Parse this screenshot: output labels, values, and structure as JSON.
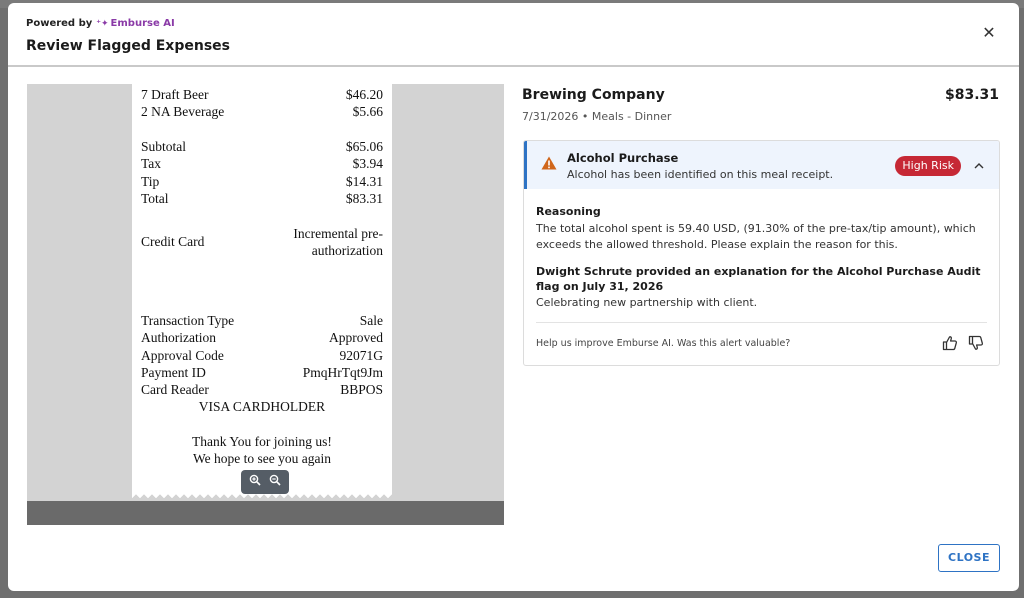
{
  "header": {
    "powered_by": "Powered by",
    "brand": "Emburse AI",
    "title": "Review Flagged Expenses",
    "close_icon": "close-icon"
  },
  "receipt": {
    "rows_top": [
      {
        "label": "7 Draft Beer",
        "value": "$46.20"
      },
      {
        "label": "2 NA Beverage",
        "value": "$5.66"
      }
    ],
    "rows_totals": [
      {
        "label": "Subtotal",
        "value": "$65.06"
      },
      {
        "label": "Tax",
        "value": "$3.94"
      },
      {
        "label": "Tip",
        "value": "$14.31"
      },
      {
        "label": "Total",
        "value": "$83.31"
      }
    ],
    "credit_card": {
      "label": "Credit Card",
      "value": "Incremental pre-authorization"
    },
    "rows_txn": [
      {
        "label": "Transaction Type",
        "value": "Sale"
      },
      {
        "label": "Authorization",
        "value": "Approved"
      },
      {
        "label": "Approval Code",
        "value": "92071G"
      },
      {
        "label": "Payment ID",
        "value": "PmqHrTqt9Jm"
      },
      {
        "label": "Card Reader",
        "value": "BBPOS"
      }
    ],
    "cardholder": "VISA CARDHOLDER",
    "thanks_1": "Thank You for joining us!",
    "thanks_2": "We hope to see you again",
    "zoom_in_icon": "zoom-in-icon",
    "zoom_out_icon": "zoom-out-icon"
  },
  "expense": {
    "merchant": "Brewing Company",
    "amount": "$83.31",
    "meta": "7/31/2026 • Meals - Dinner"
  },
  "alert": {
    "icon": "warning-icon",
    "title": "Alcohol Purchase",
    "subtitle": "Alcohol has been identified on this meal receipt.",
    "badge": "High Risk",
    "badge_color": "#c62835",
    "reasoning_title": "Reasoning",
    "reasoning_text": "The total alcohol spent is 59.40 USD, (91.30% of the pre-tax/tip amount), which exceeds the allowed threshold. Please explain the reason for this.",
    "explanation_title": "Dwight Schrute provided an explanation for the Alcohol Purchase Audit flag on July 31, 2026",
    "explanation_text": "Celebrating new partnership with client.",
    "feedback_prompt": "Help us improve Emburse AI. Was this alert valuable?"
  },
  "footer": {
    "close_label": "CLOSE"
  },
  "colors": {
    "accent": "#2e73c4",
    "brand": "#8a3aa7",
    "warning": "#d0661b"
  }
}
